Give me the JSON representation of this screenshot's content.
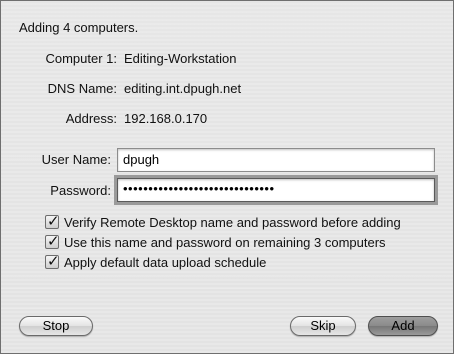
{
  "sheet": {
    "header": "Adding 4 computers.",
    "computer_label": "Computer 1:",
    "computer_name": "Editing-Workstation",
    "dns_label": "DNS Name:",
    "dns_value": "editing.int.dpugh.net",
    "address_label": "Address:",
    "address_value": "192.168.0.170",
    "username_label": "User Name:",
    "username_value": "dpugh",
    "password_label": "Password:",
    "password_mask": "••••••••••••••••••••••••••••••",
    "checkboxes": [
      {
        "label": "Verify Remote Desktop name and password before adding",
        "checked": true
      },
      {
        "label": "Use this name and password on remaining 3 computers",
        "checked": true
      },
      {
        "label": "Apply default data upload schedule",
        "checked": true
      }
    ],
    "buttons": {
      "stop": "Stop",
      "skip": "Skip",
      "add": "Add"
    },
    "check_glyph": "✓"
  },
  "colors": {
    "sheet_bg": "#ececec",
    "default_button": "#8a8a8a"
  }
}
